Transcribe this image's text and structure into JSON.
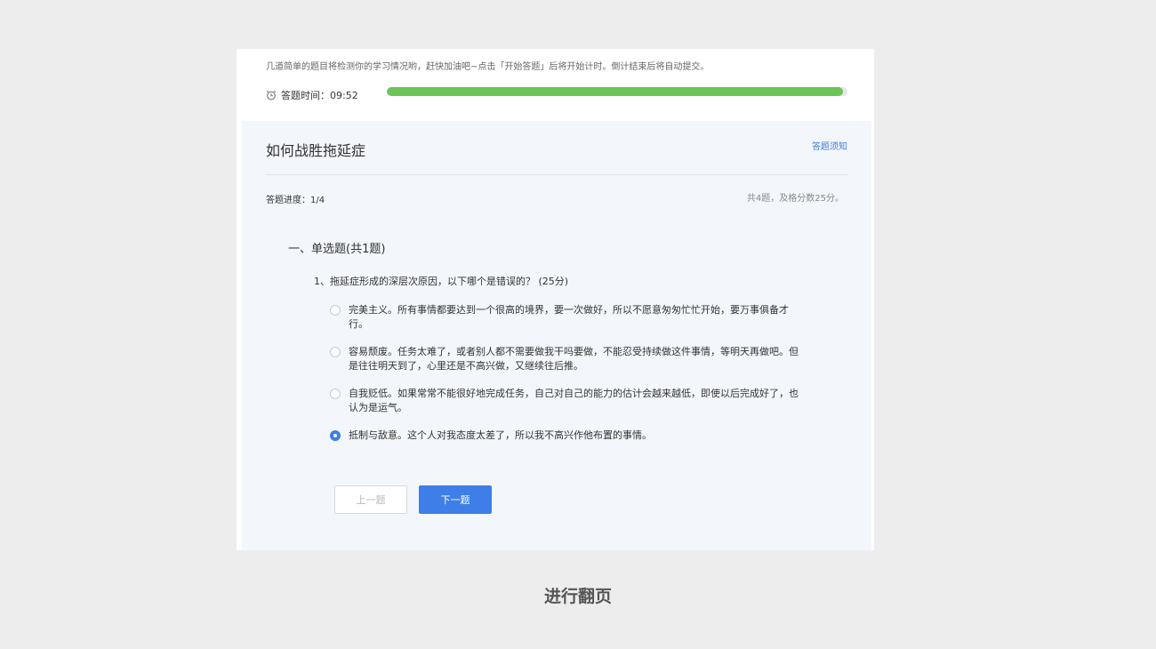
{
  "intro_text": "几道简单的题目将检测你的学习情况哟，赶快加油吧~点击「开始答题」后将开始计时。倒计结束后将自动提交。",
  "timer": {
    "label": "答题时间：09:52",
    "progress_fraction": 0.99,
    "icon": "alarm-clock-icon"
  },
  "quiz": {
    "title": "如何战胜拖延症",
    "rules_link": "答题须知",
    "progress_text": "答题进度：1/4",
    "summary_text": "共4题，及格分数25分。",
    "section_title": "一、单选题(共1题)",
    "question": "1、拖延症形成的深层次原因，以下哪个是错误的？ (25分)",
    "options": [
      {
        "label": "完美主义。所有事情都要达到一个很高的境界，要一次做好，所以不愿意匆匆忙忙开始，要万事俱备才行。",
        "selected": false
      },
      {
        "label": "容易颓废。任务太难了，或者别人都不需要做我干吗要做，不能忍受持续做这件事情，等明天再做吧。但是往往明天到了，心里还是不高兴做，又继续往后推。",
        "selected": false
      },
      {
        "label": "自我贬低。如果常常不能很好地完成任务，自己对自己的能力的估计会越来越低，即使以后完成好了，也认为是运气。",
        "selected": false
      },
      {
        "label": "抵制与敌意。这个人对我态度太差了，所以我不高兴作他布置的事情。",
        "selected": true
      }
    ],
    "prev_button": "上一题",
    "next_button": "下一题"
  },
  "caption": "进行翻页",
  "colors": {
    "accent": "#3d7ee8",
    "progress": "#6cc357",
    "panel_bg": "#f3f6fb",
    "page_bg": "#ededed"
  }
}
